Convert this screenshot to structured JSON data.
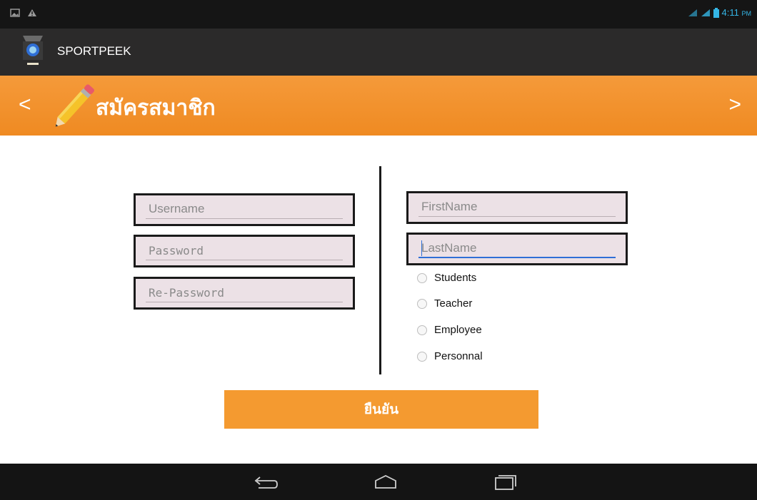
{
  "status_bar": {
    "time": "4:11",
    "ampm": "PM",
    "icons": [
      "gallery-icon",
      "warning-icon",
      "signal-icon",
      "battery-icon"
    ]
  },
  "app": {
    "title": "SPORTPEEK",
    "icon": "app-logo-icon"
  },
  "header": {
    "title": "สมัครสมาชิก",
    "prev": "<",
    "next": ">",
    "icon": "pencil-icon",
    "color": "#f0902a"
  },
  "form": {
    "username_placeholder": "Username",
    "password_placeholder": "Password",
    "repassword_placeholder": "Re-Password",
    "firstname_placeholder": "FirstName",
    "lastname_placeholder": "LastName",
    "roles": [
      {
        "label": "Students",
        "checked": false
      },
      {
        "label": "Teacher",
        "checked": false
      },
      {
        "label": "Employee",
        "checked": false
      },
      {
        "label": "Personnal",
        "checked": false
      }
    ],
    "submit_label": "ยืนยัน"
  },
  "system_nav": {
    "buttons": [
      "back-icon",
      "home-icon",
      "recents-icon"
    ]
  }
}
